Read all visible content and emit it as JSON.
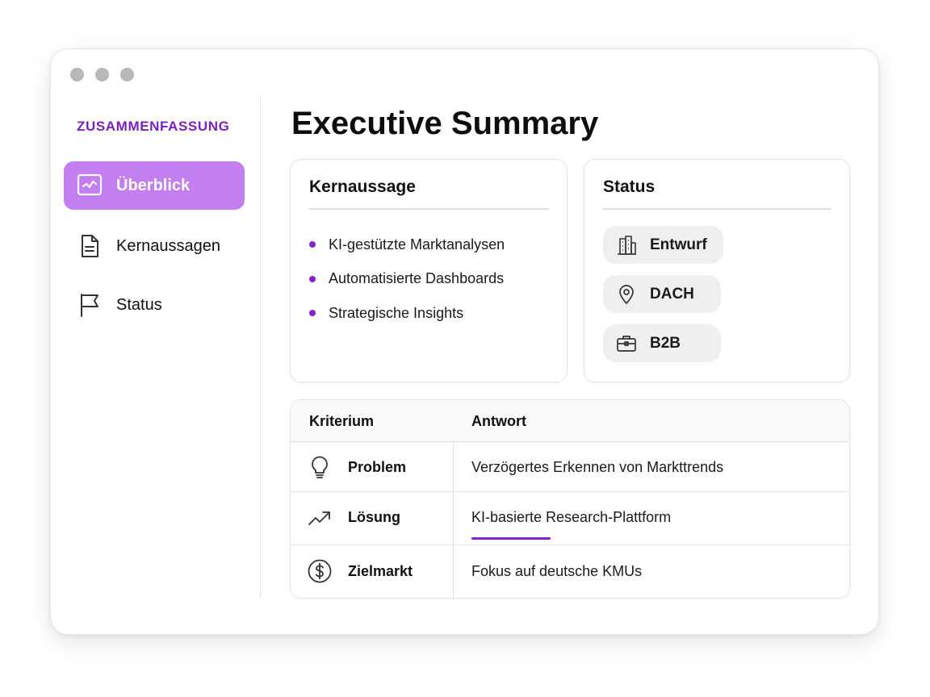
{
  "sidebar": {
    "heading": "ZUSAMMENFASSUNG",
    "items": [
      {
        "label": "Überblick",
        "icon": "chart-monitor-icon",
        "active": true
      },
      {
        "label": "Kernaussagen",
        "icon": "document-icon",
        "active": false
      },
      {
        "label": "Status",
        "icon": "flag-icon",
        "active": false
      }
    ]
  },
  "main": {
    "title": "Executive Summary",
    "kernaussage": {
      "title": "Kernaussage",
      "bullets": [
        "KI-gestützte Marktanalysen",
        "Automatisierte Dashboards",
        "Strategische Insights"
      ]
    },
    "status": {
      "title": "Status",
      "chips": [
        {
          "label": "Entwurf",
          "icon": "building-icon"
        },
        {
          "label": "DACH",
          "icon": "location-pin-icon"
        },
        {
          "label": "B2B",
          "icon": "briefcase-icon"
        }
      ]
    },
    "table": {
      "headers": [
        "Kriterium",
        "Antwort"
      ],
      "rows": [
        {
          "criterion": "Problem",
          "answer": "Verzögertes Erkennen von Markttrends",
          "icon": "lightbulb-icon"
        },
        {
          "criterion": "Lösung",
          "answer": "KI-basierte Research-Plattform",
          "icon": "trend-up-icon"
        },
        {
          "criterion": "Zielmarkt",
          "answer": "Fokus auf deutsche KMUs",
          "icon": "dollar-circle-icon"
        }
      ]
    }
  },
  "colors": {
    "accent": "#8a1fd0",
    "accent_heading": "#7b1fc4",
    "active_nav_bg": "#c37ff0",
    "chip_bg": "#efefef"
  }
}
